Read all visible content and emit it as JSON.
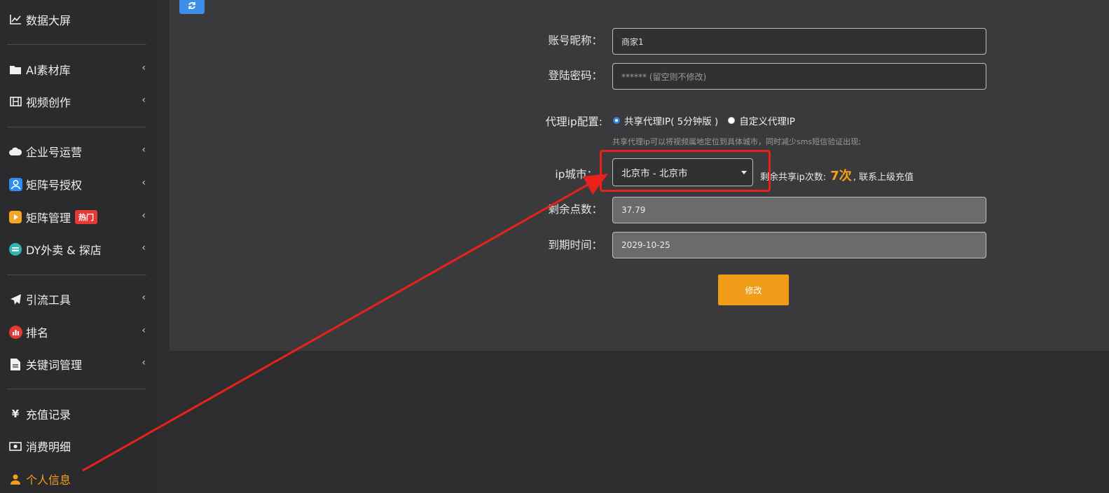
{
  "sidebar": {
    "items": [
      {
        "label": "数据大屏",
        "icon": "line-chart-icon",
        "chevron": ""
      },
      {
        "label": "AI素材库",
        "icon": "folder-icon",
        "chevron": "‹"
      },
      {
        "label": "视频创作",
        "icon": "film-icon",
        "chevron": "‹"
      },
      {
        "label": "企业号运营",
        "icon": "cloud-icon",
        "chevron": "‹"
      },
      {
        "label": "矩阵号授权",
        "icon": "user-badge-icon",
        "chevron": "‹"
      },
      {
        "label": "矩阵管理",
        "icon": "play-icon",
        "chevron": "‹",
        "badge": "热门"
      },
      {
        "label": "DY外卖 & 探店",
        "icon": "store-icon",
        "chevron": "‹"
      },
      {
        "label": "引流工具",
        "icon": "paper-plane-icon",
        "chevron": "‹"
      },
      {
        "label": "排名",
        "icon": "bar-chart-icon",
        "chevron": "‹"
      },
      {
        "label": "关键词管理",
        "icon": "document-icon",
        "chevron": "‹"
      },
      {
        "label": "充值记录",
        "icon": "yen-icon",
        "chevron": ""
      },
      {
        "label": "消费明细",
        "icon": "money-icon",
        "chevron": ""
      },
      {
        "label": "个人信息",
        "icon": "user-icon",
        "chevron": ""
      }
    ],
    "icon_glyphs": {
      "yen": "¥"
    }
  },
  "form": {
    "nickname_label": "账号昵称：",
    "nickname_value": "商家1",
    "password_label": "登陆密码：",
    "password_placeholder": "****** (留空则不修改)",
    "proxy_label": "代理ip配置:",
    "proxy_option_shared": "共享代理IP( 5分钟版 )",
    "proxy_option_custom": "自定义代理IP",
    "proxy_hint": "共享代理ip可以将视频属地定位到具体城市，同时减少sms短信验证出现;",
    "ip_city_label": "ip城市：",
    "ip_city_value": "北京市 - 北京市",
    "remaining_prefix": "剩余共享ip次数:",
    "remaining_count": "7次",
    "remaining_suffix": ", 联系上级充值",
    "points_label": "剩余点数：",
    "points_value": "37.79",
    "expire_label": "到期时间：",
    "expire_value": "2029-10-25",
    "submit_label": "修改"
  },
  "colors": {
    "accent": "#f09c18",
    "highlight": "#e8221b",
    "primary": "#3d8ee8"
  }
}
